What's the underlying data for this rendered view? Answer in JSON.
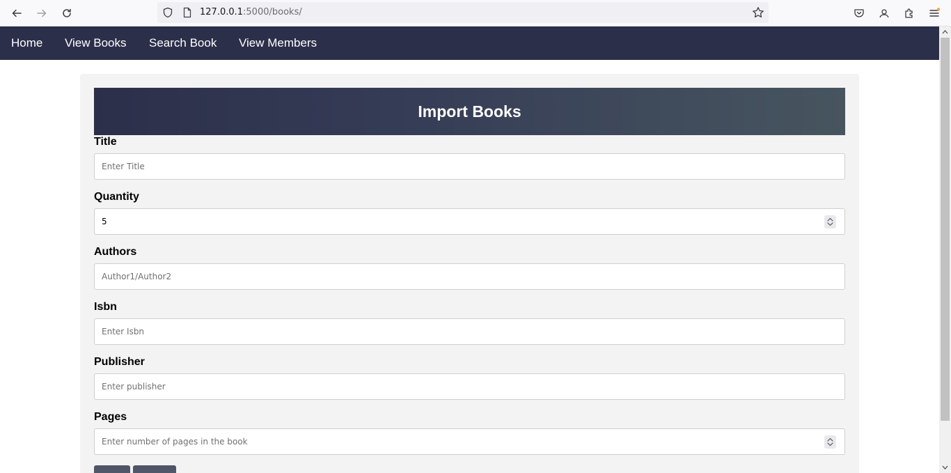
{
  "browser": {
    "url_host": "127.0.0.1",
    "url_rest": ":5000/books/"
  },
  "nav": {
    "items": [
      "Home",
      "View Books",
      "Search Book",
      "View Members"
    ]
  },
  "form": {
    "title": "Import Books",
    "fields": [
      {
        "label": "Title",
        "placeholder": "Enter Title",
        "value": ""
      },
      {
        "label": "Quantity",
        "placeholder": "",
        "value": "5"
      },
      {
        "label": "Authors",
        "placeholder": "Author1/Author2",
        "value": ""
      },
      {
        "label": "Isbn",
        "placeholder": "Enter Isbn",
        "value": ""
      },
      {
        "label": "Publisher",
        "placeholder": "Enter publisher",
        "value": ""
      },
      {
        "label": "Pages",
        "placeholder": "Enter number of pages in the book",
        "value": ""
      }
    ]
  },
  "icons": {
    "back": "arrow-left-icon",
    "forward": "arrow-right-icon",
    "reload": "reload-icon",
    "shield": "shield-icon",
    "page": "page-icon",
    "bookmark": "star-icon",
    "pocket": "pocket-icon",
    "sync": "account-sync-icon",
    "extensions": "puzzle-icon",
    "menu": "hamburger-menu-icon"
  },
  "colors": {
    "navbar": "#2c2f4a",
    "card_background": "#f3f3f3"
  }
}
